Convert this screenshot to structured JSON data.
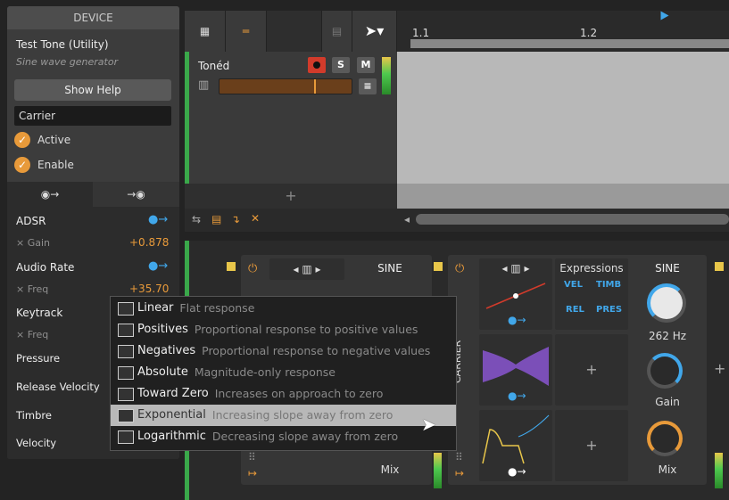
{
  "device_panel": {
    "header": "DEVICE",
    "name": "Test Tone (Utility)",
    "description": "Sine wave generator",
    "help_button": "Show Help",
    "chain_name": "Carrier",
    "toggles": [
      {
        "label": "Active",
        "checked": true
      },
      {
        "label": "Enable",
        "checked": true
      }
    ],
    "tabs": [
      "◉→",
      "→◉"
    ],
    "modulators": [
      {
        "name": "ADSR",
        "target": "Gain",
        "value": "+0.878"
      },
      {
        "name": "Audio Rate",
        "target": "Freq",
        "value": "+35.70"
      },
      {
        "name": "Keytrack",
        "target": "Freq",
        "value": ""
      },
      {
        "name": "Pressure"
      },
      {
        "name": "Release Velocity"
      },
      {
        "name": "Timbre"
      },
      {
        "name": "Velocity"
      }
    ]
  },
  "arranger": {
    "markers": [
      "1.1",
      "1.2"
    ],
    "track": {
      "name": "Tonéd",
      "solo": "S",
      "mute": "M"
    },
    "add_track": "+"
  },
  "mapping_menu": {
    "selected_index": 5,
    "items": [
      {
        "label": "Linear",
        "desc": "Flat response"
      },
      {
        "label": "Positives",
        "desc": "Proportional response to positive values"
      },
      {
        "label": "Negatives",
        "desc": "Proportional response to negative values"
      },
      {
        "label": "Absolute",
        "desc": "Magnitude-only response"
      },
      {
        "label": "Toward Zero",
        "desc": "Increases on approach to zero"
      },
      {
        "label": "Exponential",
        "desc": "Increasing slope away from zero"
      },
      {
        "label": "Logarithmic",
        "desc": "Decreasing slope away from zero"
      }
    ]
  },
  "devices": {
    "first": {
      "osc": "SINE",
      "mix": "Mix"
    },
    "carrier": {
      "label": "CARRIER",
      "expressions_title": "Expressions",
      "expressions": [
        "VEL",
        "TIMB",
        "REL",
        "PRES"
      ],
      "osc": "SINE",
      "freq": "262 Hz",
      "gain": "Gain",
      "mix": "Mix",
      "add": "+"
    }
  },
  "colors": {
    "accent": "#e89a3a",
    "blue": "#41a7ea",
    "track_green": "#3aa84a",
    "record": "#d23b2b"
  }
}
